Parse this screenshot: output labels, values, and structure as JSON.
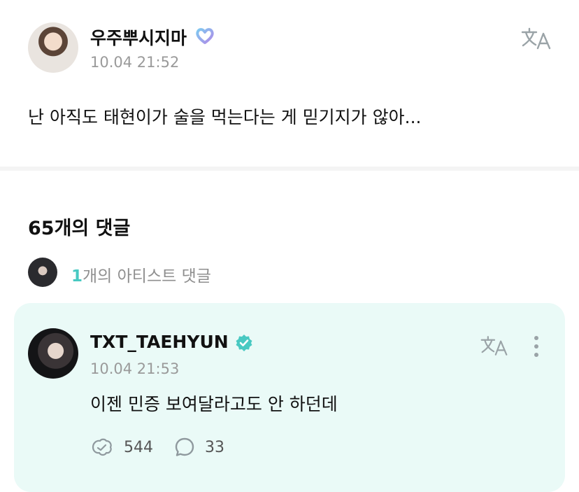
{
  "post": {
    "author": "우주뿌시지마",
    "time": "10.04 21:52",
    "text": "난 아직도 태현이가 술을 먹는다는 게 믿기지가 않아..."
  },
  "comments": {
    "title": "65개의 댓글",
    "artist_count_num": "1",
    "artist_count_text": "개의 아티스트 댓글"
  },
  "artist_comment": {
    "author": "TXT_TAEHYUN",
    "time": "10.04 21:53",
    "text": "이젠 민증 보여달라고도 안 하던데",
    "likes": "544",
    "replies": "33"
  },
  "colors": {
    "accent": "#48c9c2",
    "card_bg": "#eafaf7",
    "verified_badge": "#48c9c2"
  },
  "icons": [
    "translate-icon",
    "heart-badge-icon",
    "verified-icon",
    "more-vertical-icon",
    "like-icon",
    "comment-icon"
  ]
}
